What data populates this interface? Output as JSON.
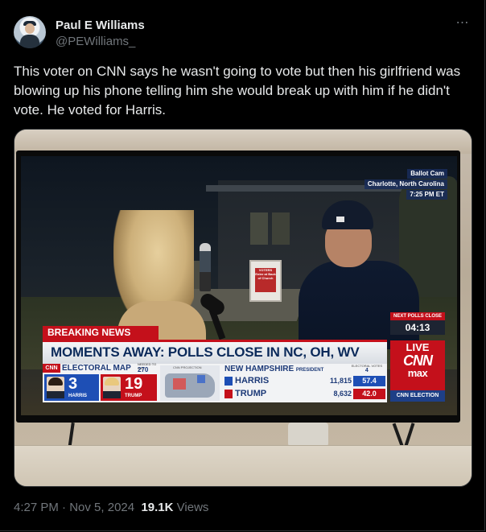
{
  "author": {
    "display_name": "Paul E Williams",
    "handle": "@PEWilliams_"
  },
  "more_icon": "⋯",
  "tweet": {
    "text": "This voter on CNN says he wasn't going to vote but then his girlfriend was blowing up his phone telling him she would break up with him if he didn't vote. He voted for Harris."
  },
  "broadcast": {
    "location": {
      "line1": "Ballot Cam",
      "line2": "Charlotte, North Carolina",
      "line3": "7:25 PM ET"
    },
    "sign": "VOTERS Enter at Back of Church",
    "breaking_label": "BREAKING NEWS",
    "headline": "MOMENTS AWAY: POLLS CLOSE IN NC, OH, WV",
    "next_polls": {
      "label": "NEXT POLLS CLOSE",
      "countdown": "04:13"
    },
    "live": "LIVE",
    "network_logo": "CNN",
    "network_sub": "max",
    "cnn_election": "CNN ELECTION",
    "cnn_mini": "CNN",
    "electoral_map": {
      "title": "ELECTORAL MAP",
      "needed_label": "NEEDED TO WIN",
      "needed_value": "270",
      "map_caption": "CNN PROJECTION",
      "harris": {
        "name": "HARRIS",
        "ev": "3"
      },
      "trump": {
        "name": "TRUMP",
        "ev": "19"
      }
    },
    "race": {
      "state": "NEW HAMPSHIRE",
      "office": "PRESIDENT",
      "reporting_label": "ELECTORAL VOTES",
      "reporting_value": "4",
      "candidates": [
        {
          "name": "HARRIS",
          "votes": "11,815",
          "pct": "57.4"
        },
        {
          "name": "TRUMP",
          "votes": "8,632",
          "pct": "42.0"
        }
      ]
    }
  },
  "footer": {
    "time": "4:27 PM",
    "separator": " · ",
    "date": "Nov 5, 2024",
    "views_count": "19.1K",
    "views_label": "Views"
  }
}
